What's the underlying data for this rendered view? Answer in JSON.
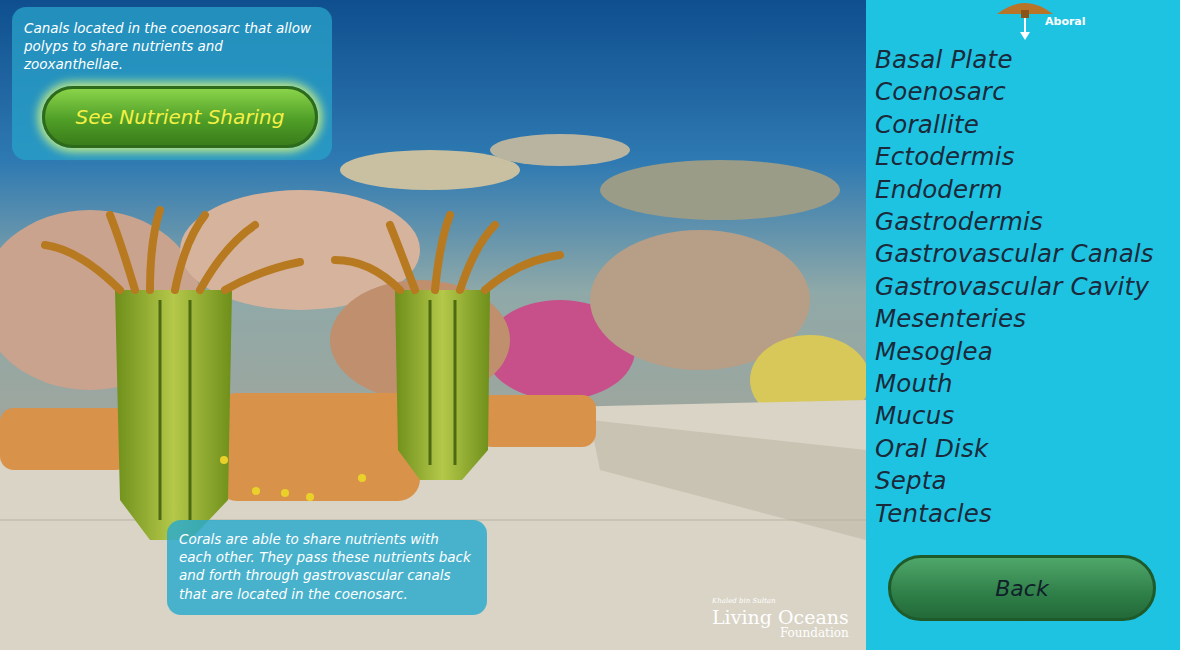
{
  "info_box": {
    "text": "Canals located in the coenosarc that allow polyps to share nutrients and zooxanthellae.",
    "button": "See Nutrient Sharing"
  },
  "caption": "Corals are able to share nutrients with each other. They pass these nutrients back and forth through gastrovascular canals that are located in the coenosarc.",
  "logo": {
    "line1": "Khaled bin Sultan",
    "line2": "Living Oceans",
    "line3": "Foundation"
  },
  "orientation": {
    "label": "Aboral"
  },
  "terms": [
    "Basal Plate",
    "Coenosarc",
    "Corallite",
    "Ectodermis",
    "Endoderm",
    "Gastrodermis",
    "Gastrovascular Canals",
    "Gastrovascular Cavity",
    "Mesenteries",
    "Mesoglea",
    "Mouth",
    "Mucus",
    "Oral Disk",
    "Septa",
    "Tentacles"
  ],
  "buttons": [
    "Back"
  ]
}
